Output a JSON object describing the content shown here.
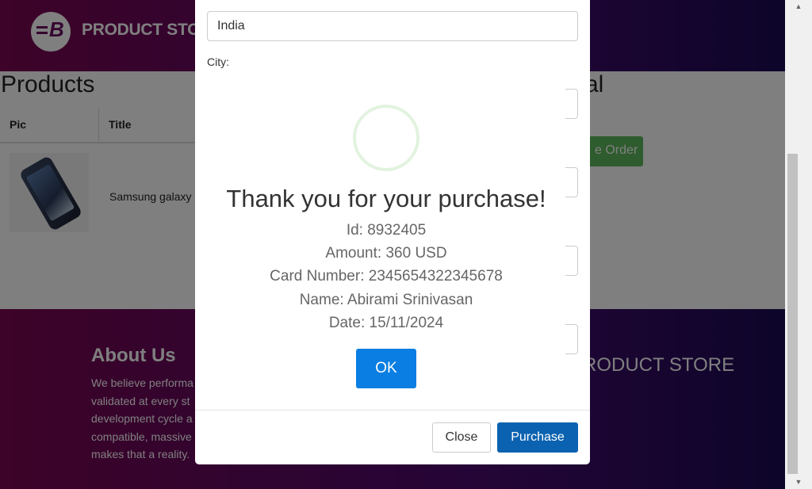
{
  "navbar": {
    "brand": "PRODUCT STORE"
  },
  "products": {
    "title": "Products",
    "columns": [
      "Pic",
      "Title"
    ],
    "rows": [
      {
        "title": "Samsung galaxy s"
      }
    ]
  },
  "cart": {
    "total_title": "al",
    "place_order_label": "e Order"
  },
  "footer": {
    "about_title": "About Us",
    "about_lines": [
      "We believe performa",
      "validated at every st",
      "development cycle a",
      "compatible, massive",
      "makes that a reality."
    ],
    "brand": "RODUCT STORE"
  },
  "order_modal": {
    "country_value": "India",
    "city_label": "City:",
    "close_label": "Close",
    "purchase_label": "Purchase"
  },
  "confirmation": {
    "title": "Thank you for your purchase!",
    "id_line": "Id: 8932405",
    "amount_line": "Amount: 360 USD",
    "card_line": "Card Number: 2345654322345678",
    "name_line": "Name: Abirami Srinivasan",
    "date_line": "Date: 15/11/2024",
    "ok_label": "OK"
  },
  "scrollbar": {
    "up_icon": "▲",
    "down_icon": "▼"
  }
}
